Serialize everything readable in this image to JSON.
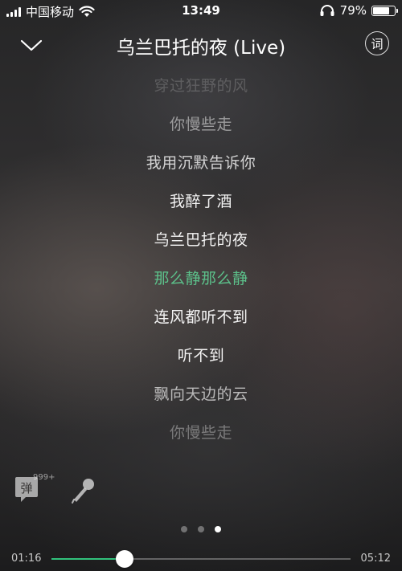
{
  "status_bar": {
    "carrier": "中国移动",
    "time": "13:49",
    "battery_percent_label": "79%",
    "battery_level": 0.79,
    "signal_bars": 4
  },
  "header": {
    "title": "乌兰巴托的夜 (Live)",
    "lyric_button_label": "词"
  },
  "lyrics": [
    {
      "text": "穿过狂野的风",
      "opacity": 0.18
    },
    {
      "text": "你慢些走",
      "opacity": 0.5
    },
    {
      "text": "我用沉默告诉你",
      "opacity": 0.78
    },
    {
      "text": "我醉了酒",
      "opacity": 0.95
    },
    {
      "text": "乌兰巴托的夜",
      "opacity": 0.95
    },
    {
      "text": "那么静那么静",
      "opacity": 1.0,
      "current": true
    },
    {
      "text": "连风都听不到",
      "opacity": 0.95
    },
    {
      "text": "听不到",
      "opacity": 0.95
    },
    {
      "text": "飘向天边的云",
      "opacity": 0.65
    },
    {
      "text": "你慢些走",
      "opacity": 0.35
    }
  ],
  "actions": {
    "danmu_label": "弹",
    "danmu_count": "999+"
  },
  "pager": {
    "count": 3,
    "active": 2
  },
  "progress": {
    "current_time": "01:16",
    "total_time": "05:12",
    "fraction": 0.2436
  },
  "colors": {
    "accent": "#31c27c",
    "current_lyric": "#5cc08a"
  }
}
